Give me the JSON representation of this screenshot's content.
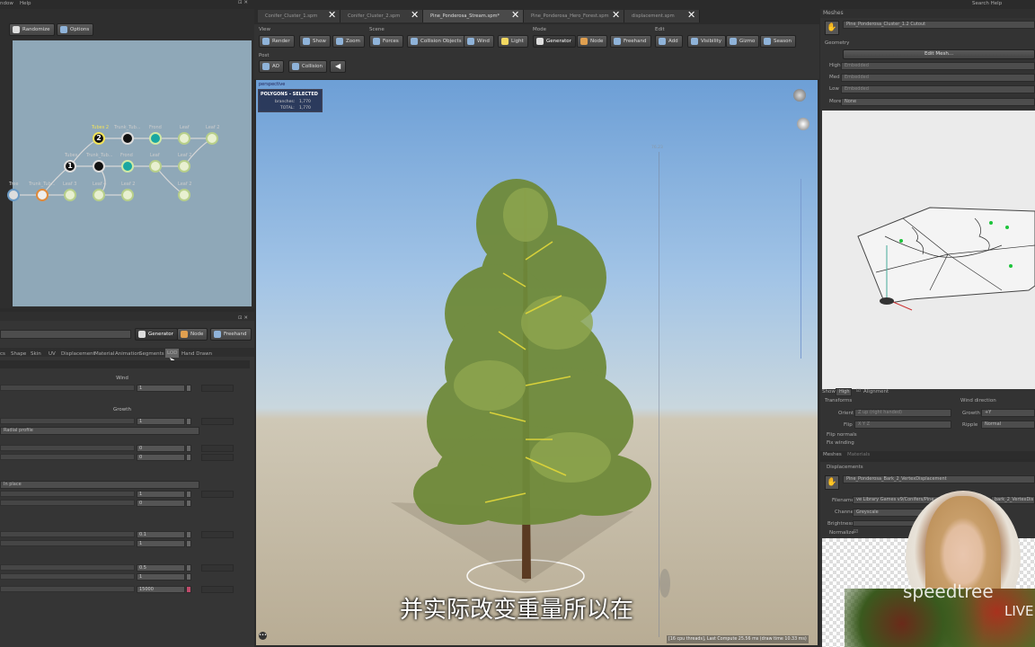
{
  "menu": {
    "window": "ndow",
    "help": "Help",
    "search_help": "Search Help"
  },
  "graph_panel": {
    "randomize": "Randomize",
    "options": "Options"
  },
  "graph_nodes": [
    {
      "label": "Tree"
    },
    {
      "label": "Trunk_Tub..."
    },
    {
      "label": "Leaf 3"
    },
    {
      "label": "Tubes"
    },
    {
      "label": "Trunk_Tub..."
    },
    {
      "label": "Frond"
    },
    {
      "label": "Leaf"
    },
    {
      "label": "Leaf 2"
    },
    {
      "label": "Tubes 2"
    },
    {
      "label": "Trunk_Tub..."
    },
    {
      "label": "Frond"
    },
    {
      "label": "Leaf"
    },
    {
      "label": "Leaf 2"
    },
    {
      "label": "Leaf 4"
    },
    {
      "label": "Leaf 2"
    },
    {
      "label": "Leaf 2"
    },
    {
      "label": "1"
    },
    {
      "label": "2"
    }
  ],
  "properties": {
    "modes": [
      "Generator",
      "Node",
      "Freehand"
    ],
    "tabs": [
      "cs",
      "Shape",
      "Skin",
      "UV",
      "Displacement",
      "Material",
      "Animation",
      "Segments",
      "LOD",
      "Hand Drawn"
    ],
    "wind": "Wind",
    "growth": "Growth",
    "growth_value": "1",
    "wind_value": "1",
    "radial_profile": "Radial profile",
    "in_place": "In place",
    "values": [
      "0",
      "0",
      "1",
      "0",
      "0.1",
      "1",
      "0.5",
      "1",
      "15000"
    ]
  },
  "tabs": [
    {
      "label": "Conifer_Cluster_1.spm"
    },
    {
      "label": "Conifer_Cluster_2.spm"
    },
    {
      "label": "Pine_Ponderosa_Stream.spm*"
    },
    {
      "label": "Pine_Ponderosa_Hero_Forest.spm"
    },
    {
      "label": "displacement.spm"
    }
  ],
  "toolbar": {
    "view_label": "View",
    "scene_label": "Scene",
    "mode_label": "Mode",
    "edit_label": "Edit",
    "post_label": "Post",
    "view": [
      "Render",
      "Show",
      "Zoom"
    ],
    "scene": [
      "Forces",
      "Collision Objects",
      "Wind",
      "Light"
    ],
    "mode": [
      "Generator",
      "Node",
      "Freehand"
    ],
    "edit": [
      "Add",
      "Visibility",
      "Gizmo",
      "Season"
    ],
    "post": [
      "AO",
      "Collision"
    ]
  },
  "viewport": {
    "camera": "perspective",
    "selection_title": "POLYGONS - SELECTED",
    "branches_label": "branches:",
    "branches_value": "1,770",
    "total_label": "TOTAL:",
    "total_value": "1,770",
    "height_marker": "76.23",
    "status": "[16 cpu threads], Last Compute 25.56 ms (draw time 10.33 ms)"
  },
  "subtitle": "并实际改变重量所以在",
  "meshes": {
    "title": "Meshes",
    "mesh_name": "Pine_Ponderosa_Cluster_1.2 Cutout",
    "geometry": "Geometry",
    "edit_mesh": "Edit Mesh...",
    "lods": [
      {
        "label": "High",
        "value": "Embedded"
      },
      {
        "label": "Med",
        "value": "Embedded"
      },
      {
        "label": "Low",
        "value": "Embedded"
      },
      {
        "label": "More",
        "value": "None"
      }
    ],
    "show_label": "Show",
    "show_value": "High",
    "alignment": "Alignment",
    "transforms": "Transforms",
    "orient_label": "Orient",
    "orient_value": "Z up (right handed)",
    "flip_label": "Flip",
    "flip_value": "X Y Z",
    "flip_normals": "Flip normals",
    "fix_winding": "Fix winding",
    "wind_direction": "Wind direction",
    "growth_label": "Growth",
    "growth_value": "+Y",
    "ripple_label": "Ripple",
    "ripple_value": "Normal",
    "tab_meshes": "Meshes",
    "tab_materials": "Materials"
  },
  "displacements": {
    "title": "Displacements",
    "name": "Pine_Ponderosa_Bark_2_VertexDisplacement",
    "filename_label": "Filename",
    "filename_value": "ve Library Games v9/Conifers/Pine_",
    "filename_tail": "bark_2_VertexDis",
    "channel_label": "Channel",
    "channel_value": "Greyscale",
    "brightness_label": "Brightness",
    "normalize_label": "Normalize"
  },
  "watermark": {
    "brand": "speedtree",
    "live": "LIVE"
  }
}
